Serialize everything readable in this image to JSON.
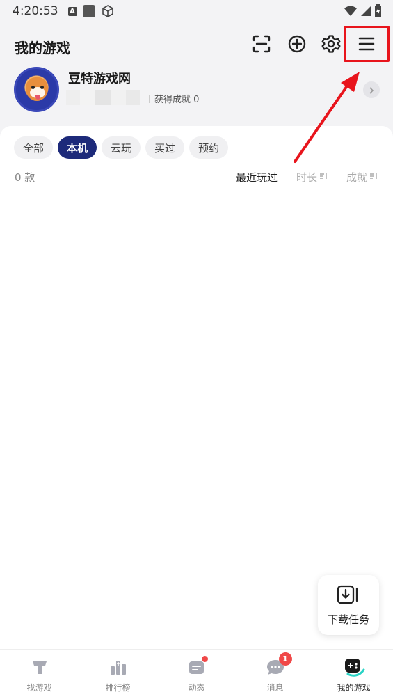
{
  "status_bar": {
    "time": "4:20:53",
    "icons": [
      "font-a-icon",
      "square-app-icon",
      "box-icon",
      "wifi-icon",
      "signal-icon",
      "battery-icon"
    ]
  },
  "header": {
    "title": "我的游戏",
    "actions": [
      "scan-icon",
      "add-circle-icon",
      "settings-icon",
      "menu-icon"
    ]
  },
  "profile": {
    "name": "豆特游戏网",
    "achievements": "获得成就 0"
  },
  "filters": [
    {
      "label": "全部",
      "active": false
    },
    {
      "label": "本机",
      "active": true
    },
    {
      "label": "云玩",
      "active": false
    },
    {
      "label": "买过",
      "active": false
    },
    {
      "label": "预约",
      "active": false
    }
  ],
  "list": {
    "count": "0 款"
  },
  "sorts": [
    {
      "label": "最近玩过",
      "active": true
    },
    {
      "label": "时长",
      "active": false
    },
    {
      "label": "成就",
      "active": false
    }
  ],
  "download_task": {
    "label": "下载任务"
  },
  "bottom_nav": [
    {
      "label": "找游戏",
      "icon": "find-game-icon",
      "active": false
    },
    {
      "label": "排行榜",
      "icon": "ranking-icon",
      "active": false
    },
    {
      "label": "动态",
      "icon": "feed-icon",
      "active": false,
      "dot": true
    },
    {
      "label": "消息",
      "icon": "message-icon",
      "active": false,
      "badge": "1"
    },
    {
      "label": "我的游戏",
      "icon": "my-games-icon",
      "active": true
    }
  ],
  "colors": {
    "accent": "#1d2a7a",
    "highlight": "#e8141c",
    "badge": "#f04848"
  }
}
